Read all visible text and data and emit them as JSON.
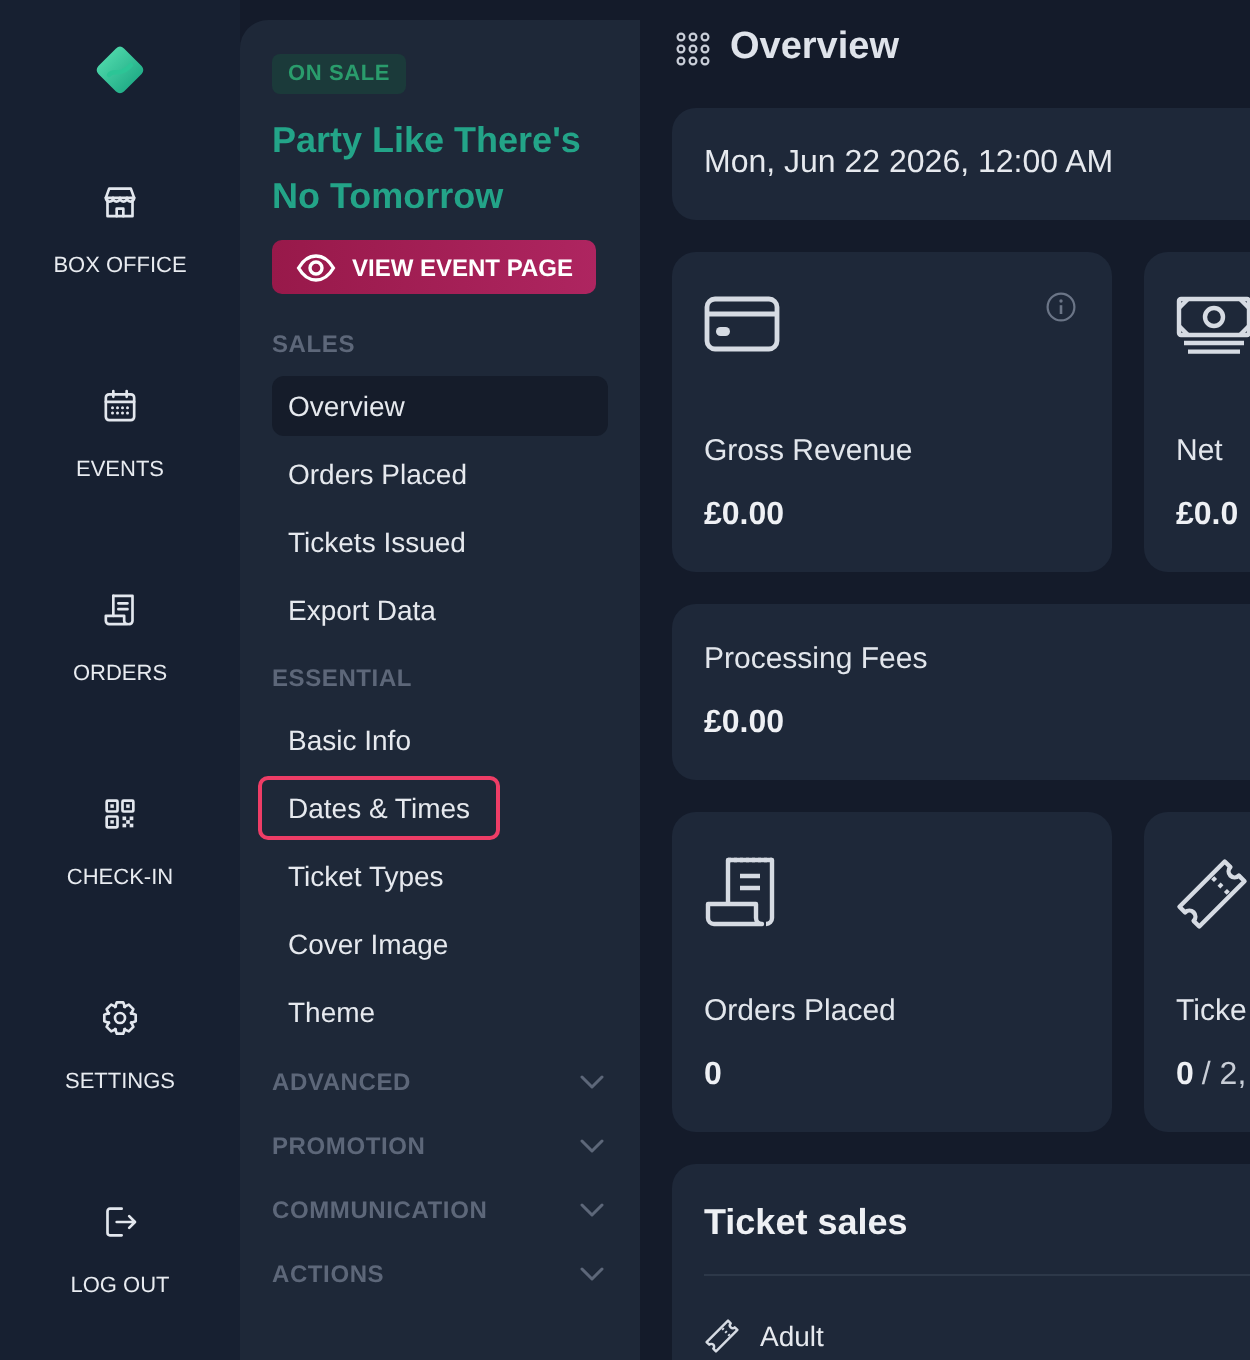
{
  "rail": {
    "items": [
      {
        "label": "BOX OFFICE"
      },
      {
        "label": "EVENTS"
      },
      {
        "label": "ORDERS"
      },
      {
        "label": "CHECK-IN"
      },
      {
        "label": "SETTINGS"
      },
      {
        "label": "LOG OUT"
      }
    ]
  },
  "sidebar": {
    "status": "ON SALE",
    "event_title": "Party Like There's No Tomorrow",
    "view_button": "VIEW EVENT PAGE",
    "sections": [
      {
        "heading": "SALES",
        "items": [
          {
            "label": "Overview",
            "selected": true,
            "focused": false
          },
          {
            "label": "Orders Placed",
            "selected": false,
            "focused": false
          },
          {
            "label": "Tickets Issued",
            "selected": false,
            "focused": false
          },
          {
            "label": "Export Data",
            "selected": false,
            "focused": false
          }
        ]
      },
      {
        "heading": "ESSENTIAL",
        "items": [
          {
            "label": "Basic Info",
            "selected": false,
            "focused": false
          },
          {
            "label": "Dates & Times",
            "selected": false,
            "focused": true
          },
          {
            "label": "Ticket Types",
            "selected": false,
            "focused": false
          },
          {
            "label": "Cover Image",
            "selected": false,
            "focused": false
          },
          {
            "label": "Theme",
            "selected": false,
            "focused": false
          }
        ]
      }
    ],
    "collapsible": [
      {
        "heading": "ADVANCED",
        "expanded": false
      },
      {
        "heading": "PROMOTION",
        "expanded": false
      },
      {
        "heading": "COMMUNICATION",
        "expanded": false
      },
      {
        "heading": "ACTIONS",
        "expanded": false
      }
    ]
  },
  "main": {
    "title": "Overview",
    "date": "Mon, Jun 22 2026, 12:00 AM",
    "stat_rows": [
      {
        "cards": [
          {
            "kind": "icon",
            "label": "Gross Revenue",
            "value": "£0.00",
            "info": true
          },
          {
            "kind": "icon",
            "label": "Net",
            "value": "£0.0"
          }
        ]
      },
      {
        "cards": [
          {
            "kind": "plain",
            "label": "Processing Fees",
            "value": "£0.00"
          }
        ]
      },
      {
        "cards": [
          {
            "kind": "icon",
            "label": "Orders Placed",
            "value": "0"
          },
          {
            "kind": "icon",
            "label": "Ticke",
            "value": "0",
            "total": "/ 2,"
          }
        ]
      }
    ],
    "ticket_sales": {
      "title": "Ticket sales",
      "rows": [
        {
          "name": "Adult"
        }
      ]
    }
  }
}
